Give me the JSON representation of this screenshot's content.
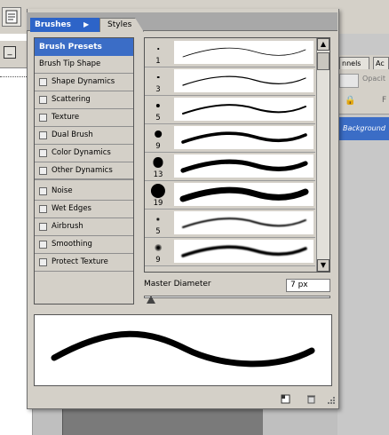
{
  "tabs": {
    "brushes": "Brushes",
    "styles": "Styles"
  },
  "options": {
    "header": "Brush Presets",
    "tip_shape": "Brush Tip Shape",
    "items": [
      {
        "label": "Shape Dynamics",
        "checked": false
      },
      {
        "label": "Scattering",
        "checked": false
      },
      {
        "label": "Texture",
        "checked": false
      },
      {
        "label": "Dual Brush",
        "checked": false
      },
      {
        "label": "Color Dynamics",
        "checked": false
      },
      {
        "label": "Other Dynamics",
        "checked": false
      },
      {
        "label": "Noise",
        "checked": false
      },
      {
        "label": "Wet Edges",
        "checked": false
      },
      {
        "label": "Airbrush",
        "checked": false
      },
      {
        "label": "Smoothing",
        "checked": false
      },
      {
        "label": "Protect Texture",
        "checked": false
      }
    ]
  },
  "presets": [
    {
      "size": "1",
      "style": "hard"
    },
    {
      "size": "3",
      "style": "hard"
    },
    {
      "size": "5",
      "style": "hard"
    },
    {
      "size": "9",
      "style": "hard"
    },
    {
      "size": "13",
      "style": "hard"
    },
    {
      "size": "19",
      "style": "hard"
    },
    {
      "size": "5",
      "style": "soft"
    },
    {
      "size": "9",
      "style": "soft"
    }
  ],
  "master_diameter": {
    "label": "Master Diameter",
    "value": "7 px",
    "slider_fraction": 0.02
  },
  "background": {
    "tab_channels": "nnels",
    "tab_actions": "Ac",
    "opacity_label": "Opacit",
    "layer_name": "Background",
    "F": "F"
  },
  "colors": {
    "accent": "#3b6dc6",
    "tab_active": "#2d64c8",
    "panel": "#d4d0c8"
  }
}
